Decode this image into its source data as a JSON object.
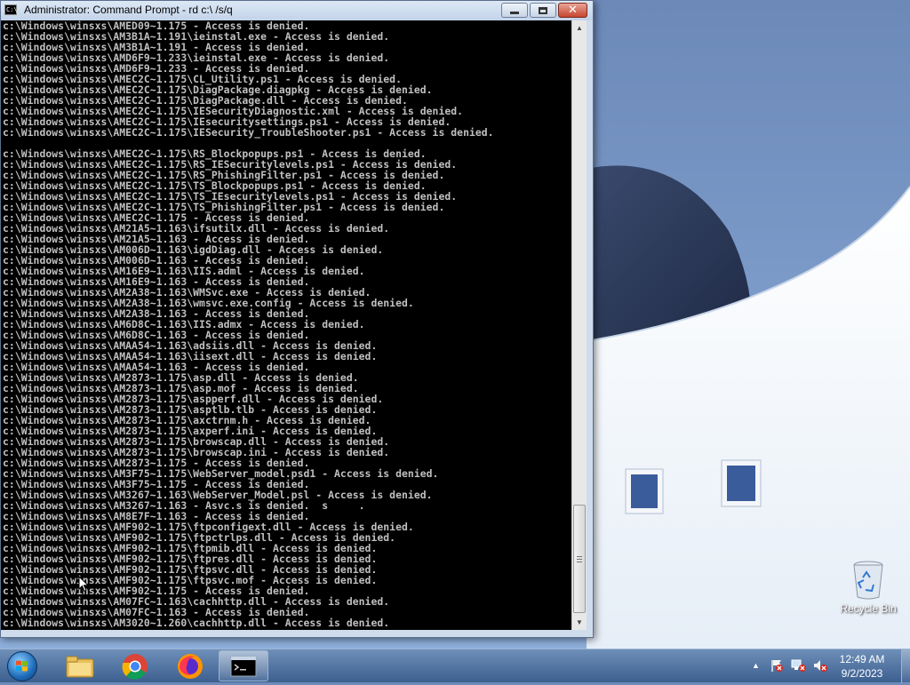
{
  "window": {
    "title": "Administrator: Command Prompt - rd  c:\\ /s/q",
    "icon_label": "C:\\"
  },
  "console": {
    "lines": [
      "c:\\Windows\\winsxs\\AMED09~1.175 - Access is denied.",
      "c:\\Windows\\winsxs\\AM3B1A~1.191\\ieinstal.exe - Access is denied.",
      "c:\\Windows\\winsxs\\AM3B1A~1.191 - Access is denied.",
      "c:\\Windows\\winsxs\\AMD6F9~1.233\\ieinstal.exe - Access is denied.",
      "c:\\Windows\\winsxs\\AMD6F9~1.233 - Access is denied.",
      "c:\\Windows\\winsxs\\AMEC2C~1.175\\CL_Utility.ps1 - Access is denied.",
      "c:\\Windows\\winsxs\\AMEC2C~1.175\\DiagPackage.diagpkg - Access is denied.",
      "c:\\Windows\\winsxs\\AMEC2C~1.175\\DiagPackage.dll - Access is denied.",
      "c:\\Windows\\winsxs\\AMEC2C~1.175\\IESecurityDiagnostic.xml - Access is denied.",
      "c:\\Windows\\winsxs\\AMEC2C~1.175\\IEsecuritysettings.ps1 - Access is denied.",
      "c:\\Windows\\winsxs\\AMEC2C~1.175\\IESecurity_TroubleShooter.ps1 - Access is denied.",
      "",
      "c:\\Windows\\winsxs\\AMEC2C~1.175\\RS_Blockpopups.ps1 - Access is denied.",
      "c:\\Windows\\winsxs\\AMEC2C~1.175\\RS_IESecuritylevels.ps1 - Access is denied.",
      "c:\\Windows\\winsxs\\AMEC2C~1.175\\RS_PhishingFilter.ps1 - Access is denied.",
      "c:\\Windows\\winsxs\\AMEC2C~1.175\\TS_Blockpopups.ps1 - Access is denied.",
      "c:\\Windows\\winsxs\\AMEC2C~1.175\\TS_IEsecuritylevels.ps1 - Access is denied.",
      "c:\\Windows\\winsxs\\AMEC2C~1.175\\TS_PhishingFilter.ps1 - Access is denied.",
      "c:\\Windows\\winsxs\\AMEC2C~1.175 - Access is denied.",
      "c:\\Windows\\winsxs\\AM21A5~1.163\\ifsutilx.dll - Access is denied.",
      "c:\\Windows\\winsxs\\AM21A5~1.163 - Access is denied.",
      "c:\\Windows\\winsxs\\AM006D~1.163\\igdDiag.dll - Access is denied.",
      "c:\\Windows\\winsxs\\AM006D~1.163 - Access is denied.",
      "c:\\Windows\\winsxs\\AM16E9~1.163\\IIS.adml - Access is denied.",
      "c:\\Windows\\winsxs\\AM16E9~1.163 - Access is denied.",
      "c:\\Windows\\winsxs\\AM2A38~1.163\\WMSvc.exe - Access is denied.",
      "c:\\Windows\\winsxs\\AM2A38~1.163\\wmsvc.exe.config - Access is denied.",
      "c:\\Windows\\winsxs\\AM2A38~1.163 - Access is denied.",
      "c:\\Windows\\winsxs\\AM6D8C~1.163\\IIS.admx - Access is denied.",
      "c:\\Windows\\winsxs\\AM6D8C~1.163 - Access is denied.",
      "c:\\Windows\\winsxs\\AMAA54~1.163\\adsiis.dll - Access is denied.",
      "c:\\Windows\\winsxs\\AMAA54~1.163\\iisext.dll - Access is denied.",
      "c:\\Windows\\winsxs\\AMAA54~1.163 - Access is denied.",
      "c:\\Windows\\winsxs\\AM2873~1.175\\asp.dll - Access is denied.",
      "c:\\Windows\\winsxs\\AM2873~1.175\\asp.mof - Access is denied.",
      "c:\\Windows\\winsxs\\AM2873~1.175\\aspperf.dll - Access is denied.",
      "c:\\Windows\\winsxs\\AM2873~1.175\\asptlb.tlb - Access is denied.",
      "c:\\Windows\\winsxs\\AM2873~1.175\\axctrnm.h - Access is denied.",
      "c:\\Windows\\winsxs\\AM2873~1.175\\axperf.ini - Access is denied.",
      "c:\\Windows\\winsxs\\AM2873~1.175\\browscap.dll - Access is denied.",
      "c:\\Windows\\winsxs\\AM2873~1.175\\browscap.ini - Access is denied.",
      "c:\\Windows\\winsxs\\AM2873~1.175 - Access is denied.",
      "c:\\Windows\\winsxs\\AM3F75~1.175\\WebServer_model.psd1 - Access is denied.",
      "c:\\Windows\\winsxs\\AM3F75~1.175 - Access is denied.",
      "c:\\Windows\\winsxs\\AM3267~1.163\\WebServer_Model.psl - Access is denied.",
      "c:\\Windows\\winsxs\\AM3267~1.163 - Asvc.s is denied.  s     .",
      "c:\\Windows\\winsxs\\AM8E7F~1.163 - Access is denied.",
      "c:\\Windows\\winsxs\\AMF902~1.175\\ftpconfigext.dll - Access is denied.",
      "c:\\Windows\\winsxs\\AMF902~1.175\\ftpctrlps.dll - Access is denied.",
      "c:\\Windows\\winsxs\\AMF902~1.175\\ftpmib.dll - Access is denied.",
      "c:\\Windows\\winsxs\\AMF902~1.175\\ftpres.dll - Access is denied.",
      "c:\\Windows\\winsxs\\AMF902~1.175\\ftpsvc.dll - Access is denied.",
      "c:\\Windows\\winsxs\\AMF902~1.175\\ftpsvc.mof - Access is denied.",
      "c:\\Windows\\winsxs\\AMF902~1.175 - Access is denied.",
      "c:\\Windows\\winsxs\\AM07FC~1.163\\cachhttp.dll - Access is denied.",
      "c:\\Windows\\winsxs\\AM07FC~1.163 - Access is denied.",
      "c:\\Windows\\winsxs\\AM3020~1.260\\cachhttp.dll - Access is denied."
    ]
  },
  "desktop": {
    "recycle_bin_label": "Recycle Bin"
  },
  "taskbar": {
    "start_icon": "windows-start-orb",
    "pinned": [
      {
        "name": "explorer",
        "icon": "folder-icon"
      },
      {
        "name": "chrome",
        "icon": "chrome-icon"
      },
      {
        "name": "firefox",
        "icon": "firefox-icon"
      },
      {
        "name": "cmd",
        "icon": "cmd-icon",
        "active": true
      }
    ],
    "clock_time": "12:49 AM",
    "clock_date": "9/2/2023"
  }
}
